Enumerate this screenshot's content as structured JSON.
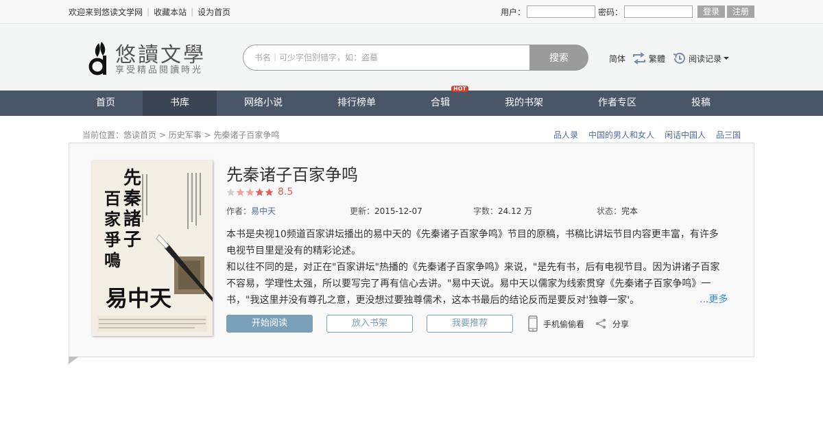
{
  "topbar": {
    "links": [
      "欢迎来到悠读文学网",
      "收藏本站",
      "设为首页"
    ],
    "user_label": "用户：",
    "pass_label": "密码：",
    "login_btn": "登录",
    "register_btn": "注册"
  },
  "header": {
    "logo_name": "悠讀文學",
    "logo_slogan": "享受精品閱讀時光",
    "search_placeholder": "书名｜可少字但别错字，如：盗墓",
    "search_btn": "搜索",
    "simplified": "简体",
    "traditional": "繁體",
    "history": "阅读记录"
  },
  "nav": {
    "items": [
      "首页",
      "书库",
      "网络小说",
      "排行榜单",
      "合辑",
      "我的书架",
      "作者专区",
      "投稿"
    ],
    "active_index": 1,
    "hot_badge": "HOT"
  },
  "breadcrumb": {
    "prefix": "当前位置：",
    "home": "悠读首页",
    "category": "历史军事",
    "current": "先秦诸子百家争鸣",
    "sep": " > "
  },
  "related": [
    "品人录",
    "中国的男人和女人",
    "闲话中国人",
    "品三国"
  ],
  "book": {
    "title": "先秦诸子百家争鸣",
    "rating": 8.5,
    "score_text": "8.5",
    "stars_filled": 4,
    "stars_total": 5,
    "author_label": "作者：",
    "author": "易中天",
    "updated_label": "更新：",
    "updated": "2015-12-07",
    "words_label": "字数：",
    "words": "24.12 万",
    "status_label": "状态：",
    "status": "完本",
    "intro_p1": "本书是央视10频道百家讲坛播出的易中天的《先秦诸子百家争鸣》节目的原稿，书稿比讲坛节目内容更丰富，有许多电视节目里是没有的精彩论述。",
    "intro_p2": "和以往不同的是，对正在\"百家讲坛\"热播的《先秦诸子百家争鸣》来说，\"是先有书，后有电视节目。因为讲诸子百家不容易，学理性太强，所以要写完了再有信心去讲。\"易中天说。易中天以儒家为线索贯穿《先秦诸子百家争鸣》一书，\"我这里并没有尊孔之意，更没想过要独尊儒术，这本书最后的结论反而是要反对'独尊一家'。",
    "more": "...更多",
    "cover_title": "先秦諸子百家爭鳴",
    "cover_author": "易中天"
  },
  "actions": {
    "read": "开始阅读",
    "shelf": "放入书架",
    "recommend": "我要推荐",
    "mobile": "手机偷偷看",
    "share": "分享"
  },
  "colors": {
    "nav_bg": "#4a5567",
    "accent": "#7aa0ba",
    "link": "#4e6aa0",
    "score": "#e35a5a"
  }
}
